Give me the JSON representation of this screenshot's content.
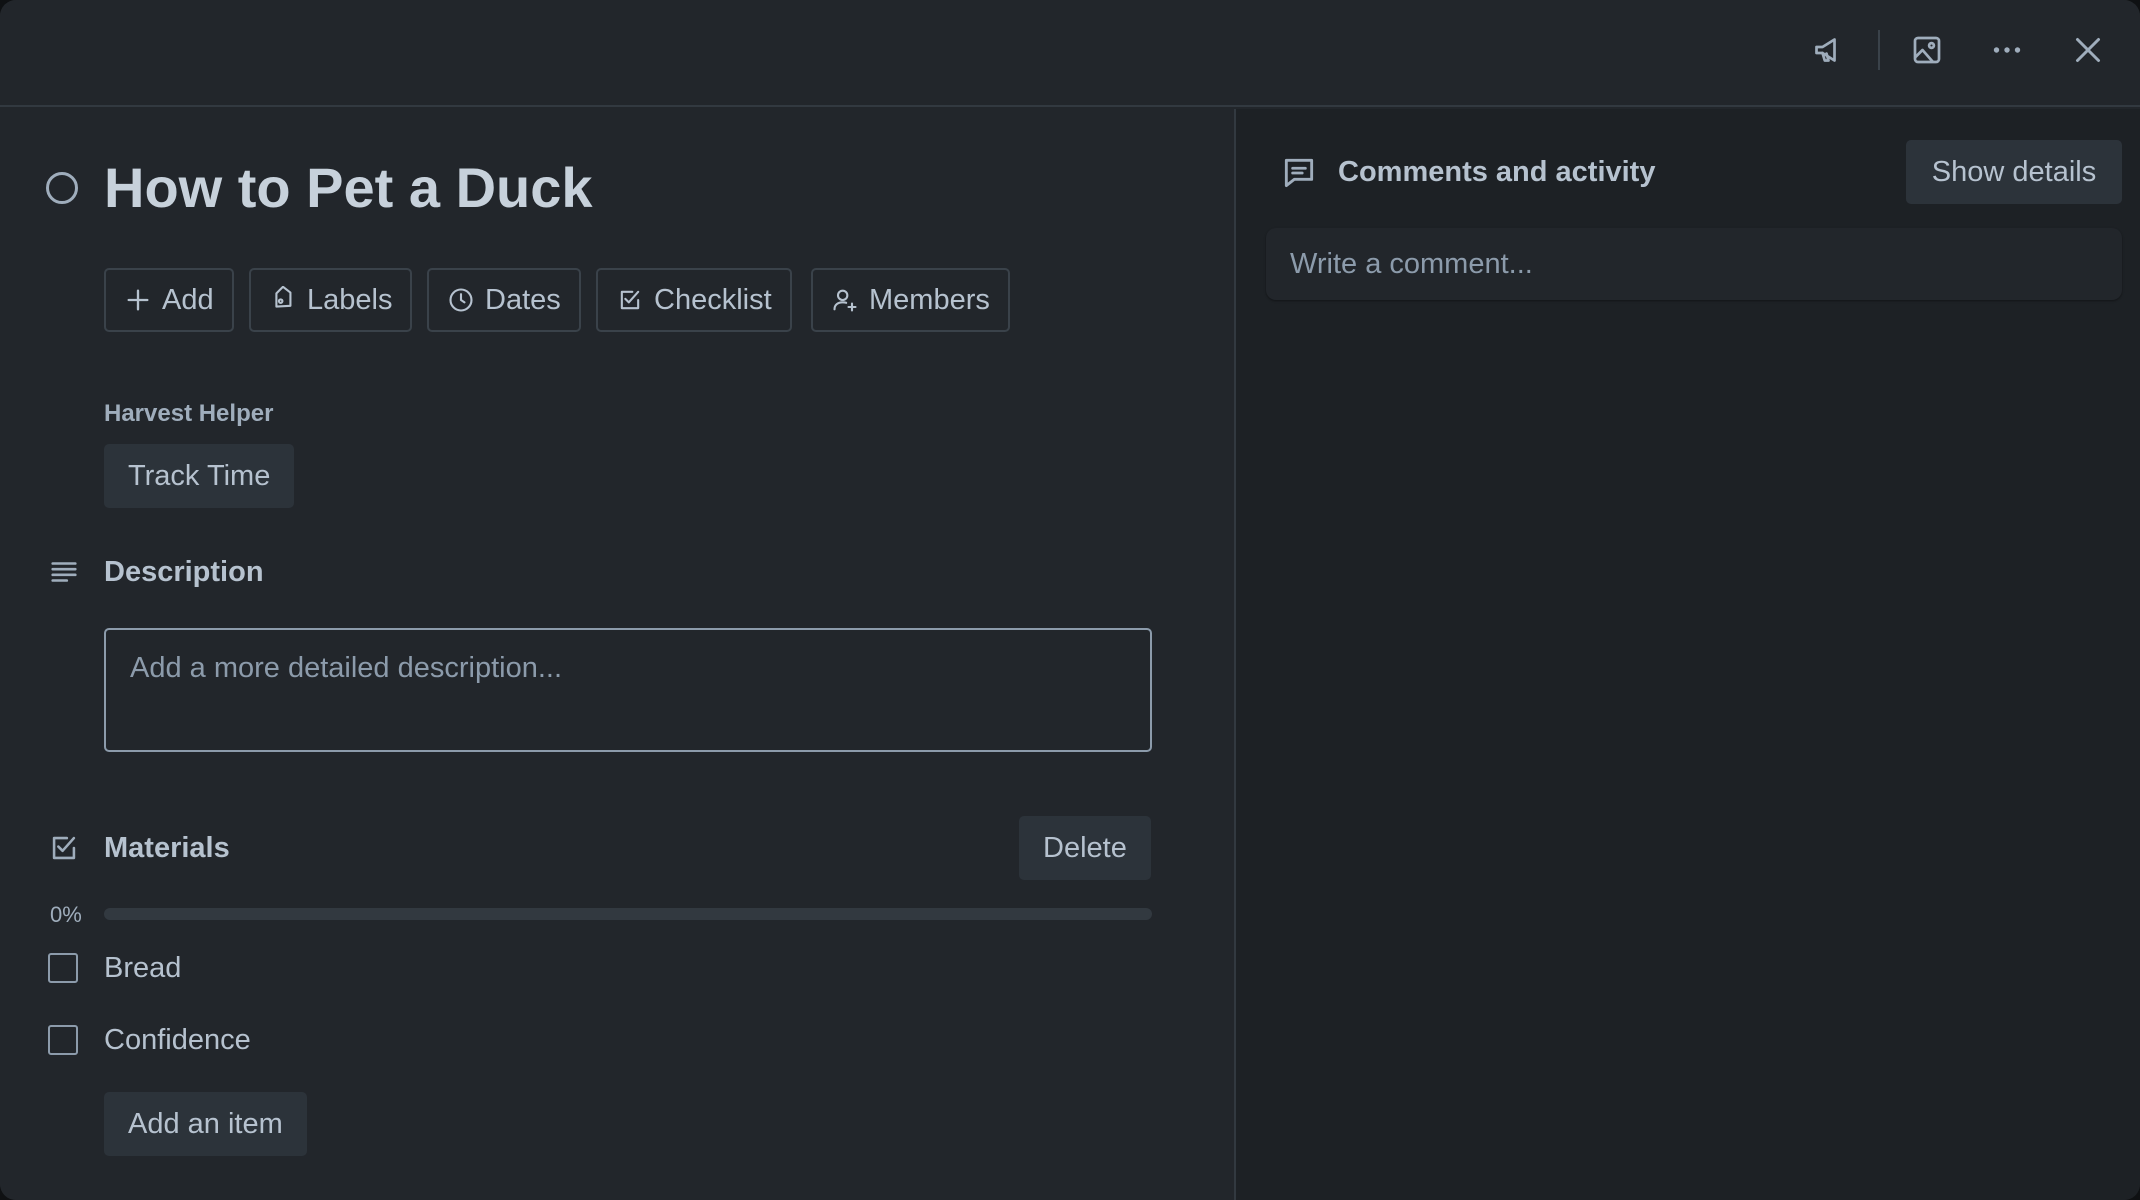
{
  "card": {
    "title": "How to Pet a Duck"
  },
  "header_icons": [
    {
      "name": "megaphone-icon"
    },
    {
      "name": "image-icon"
    },
    {
      "name": "more-icon"
    },
    {
      "name": "close-icon"
    }
  ],
  "actions": {
    "add": "Add",
    "labels": "Labels",
    "dates": "Dates",
    "checklist": "Checklist",
    "members": "Members"
  },
  "harvest": {
    "label": "Harvest Helper",
    "button": "Track Time"
  },
  "description": {
    "heading": "Description",
    "placeholder": "Add a more detailed description..."
  },
  "checklist": {
    "heading": "Materials",
    "delete_label": "Delete",
    "progress_text": "0%",
    "progress": 0,
    "items": [
      {
        "label": "Bread",
        "checked": false
      },
      {
        "label": "Confidence",
        "checked": false
      }
    ],
    "add_item_label": "Add an item"
  },
  "activity": {
    "heading": "Comments and activity",
    "show_details_label": "Show details",
    "comment_placeholder": "Write a comment..."
  },
  "colors": {
    "background": "#22262b",
    "sidebar": "#1d2125",
    "text": "#b6c2cf",
    "muted": "#9fadbc",
    "progress_fill": "#579dff"
  }
}
